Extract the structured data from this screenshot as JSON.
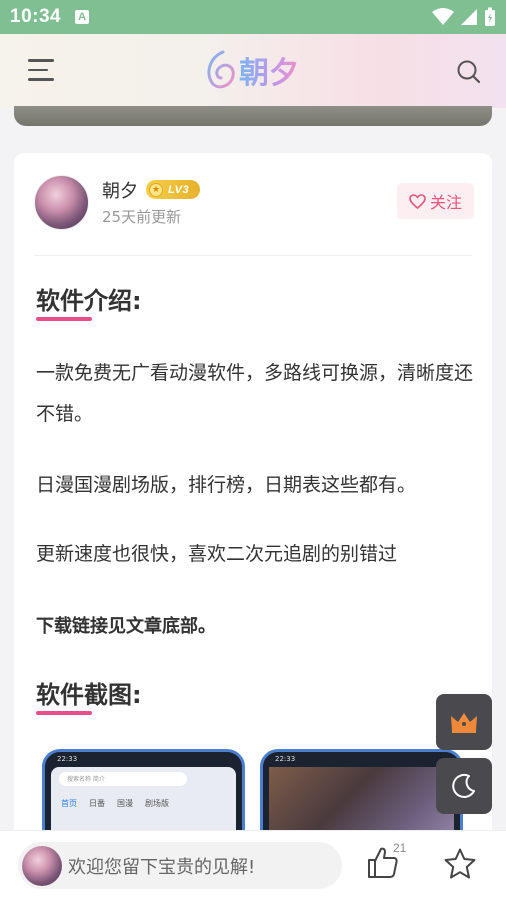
{
  "status_bar": {
    "time": "10:34",
    "notification_letter": "A"
  },
  "header": {
    "logo_text": "朝夕"
  },
  "author": {
    "name": "朝夕",
    "level": "LV3",
    "updated": "25天前更新",
    "follow_label": "关注"
  },
  "content": {
    "intro_title": "软件介绍:",
    "paragraphs": [
      "一款免费无广看动漫软件，多路线可换源，清晰度还不错。",
      "日漫国漫剧场版，排行榜，日期表这些都有。",
      "更新速度也很快，喜欢二次元追剧的别错过"
    ],
    "download_note": "下载链接见文章底部。",
    "screenshots_title": "软件截图:",
    "screenshots": [
      {
        "time": "22:33",
        "search": "搜索名称 简介",
        "tabs": [
          "首页",
          "日番",
          "国漫",
          "剧场版"
        ]
      },
      {
        "time": "22:33"
      }
    ]
  },
  "fabs": [
    "crown-icon",
    "moon-icon"
  ],
  "bottom_bar": {
    "comment_placeholder": "欢迎您留下宝贵的见解!",
    "like_count": "21"
  },
  "colors": {
    "accent": "#e94d8a",
    "status_bar": "#7fbf92",
    "follow_text": "#e9557b"
  }
}
